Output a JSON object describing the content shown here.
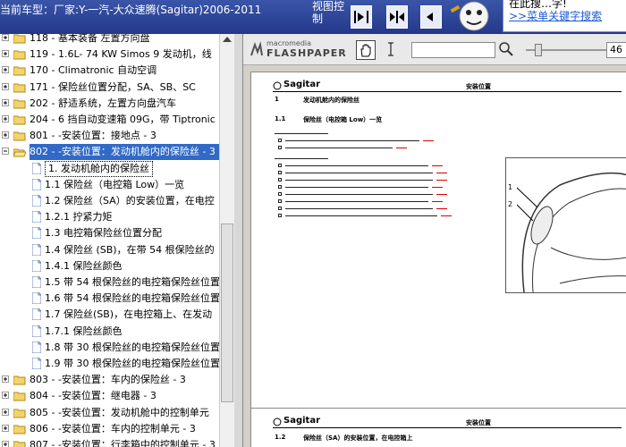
{
  "header": {
    "car_title": "当前车型：厂家:Y-一汽-大众速腾(Sagitar)2006-2011",
    "view_label": "视图控制",
    "search_tip_line1": "在此搜…字!",
    "search_tip_link": ">>菜单关键字搜索"
  },
  "tree": {
    "items": [
      {
        "label": "118 - 基本装备 左置方向盘",
        "type": "folder"
      },
      {
        "label": "119 - 1.6L- 74 KW Simos 9 发动机，线",
        "type": "folder"
      },
      {
        "label": "170 - Climatronic 自动空调",
        "type": "folder"
      },
      {
        "label": "171 - 保险丝位置分配，SA、SB、SC",
        "type": "folder"
      },
      {
        "label": "202 - 舒适系统，左置方向盘汽车",
        "type": "folder"
      },
      {
        "label": "204 - 6 挡自动变速箱 09G，带 Tiptronic",
        "type": "folder"
      },
      {
        "label": "801 - -安装位置：接地点 - 3",
        "type": "folder"
      },
      {
        "label": "802 - -安装位置：发动机舱内的保险丝 - 3",
        "type": "folder-open"
      },
      {
        "label": "1. 发动机舱内的保险丝",
        "type": "page"
      },
      {
        "label": "1.1 保险丝（电控箱 Low）一览",
        "type": "page"
      },
      {
        "label": "1.2 保险丝（SA）的安装位置，在电控",
        "type": "page"
      },
      {
        "label": "1.2.1 拧紧力矩",
        "type": "page"
      },
      {
        "label": "1.3 电控箱保险丝位置分配",
        "type": "page"
      },
      {
        "label": "1.4 保险丝 (SB)，在带 54 根保险丝的",
        "type": "page"
      },
      {
        "label": "1.4.1 保险丝颜色",
        "type": "page"
      },
      {
        "label": "1.5 带 54 根保险丝的电控箱保险丝位置",
        "type": "page"
      },
      {
        "label": "1.6 带 54 根保险丝的电控箱保险丝位置",
        "type": "page"
      },
      {
        "label": "1.7 保险丝(SB)，在电控箱上、在发动",
        "type": "page"
      },
      {
        "label": "1.7.1 保险丝颜色",
        "type": "page"
      },
      {
        "label": "1.8 带 30 根保险丝的电控箱保险丝位置",
        "type": "page"
      },
      {
        "label": "1.9 带 30 根保险丝的电控箱保险丝位置",
        "type": "page"
      },
      {
        "label": "803 - -安装位置：车内的保险丝 - 3",
        "type": "folder"
      },
      {
        "label": "804 - -安装位置：继电器 - 3",
        "type": "folder"
      },
      {
        "label": "805 - -安装位置：发动机舱中的控制单元",
        "type": "folder"
      },
      {
        "label": "806 - -安装位置：车内的控制单元 - 3",
        "type": "folder"
      },
      {
        "label": "807 - -安装位置：行李箱中的控制单元 - 3",
        "type": "folder"
      }
    ]
  },
  "viewer": {
    "logo_top": "macromedia",
    "logo_bottom": "FLASHPAPER",
    "zoom_value": "46",
    "page1": {
      "brand": "Sagitar",
      "header_right": "安装位置",
      "sec1_num": "1",
      "sec1_title": "发动机舱内的保险丝",
      "sec11_num": "1.1",
      "sec11_title": "保险丝（电控箱 Low）一览",
      "fig_label_1": "1",
      "fig_label_2": "2"
    },
    "page2": {
      "brand": "Sagitar",
      "header_right": "安装位置",
      "sec_num": "1.2",
      "sec_title": "保险丝（SA）的安装位置，在电控箱上"
    }
  },
  "colors": {
    "selection": "#3169c6",
    "header_bg": "#2b3f94",
    "link_red": "#dd0000"
  }
}
